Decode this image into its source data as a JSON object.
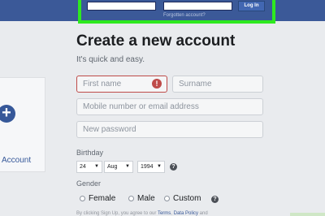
{
  "header": {
    "login_label": "Log In",
    "forgotten_label": "Forgotten account?"
  },
  "left_card": {
    "plus_symbol": "+",
    "account_label": "Account"
  },
  "form": {
    "title": "Create a new account",
    "subtitle": "It's quick and easy.",
    "first_name_placeholder": "First name",
    "surname_placeholder": "Surname",
    "mobile_placeholder": "Mobile number or email address",
    "password_placeholder": "New password",
    "error_symbol": "!",
    "birthday_label": "Birthday",
    "birthday_day": "24",
    "birthday_month": "Aug",
    "birthday_year": "1994",
    "help_symbol": "?",
    "gender_label": "Gender",
    "gender_female": "Female",
    "gender_male": "Male",
    "gender_custom": "Custom",
    "fine_print_prefix": "By clicking Sign Up, you agree to our",
    "fine_terms": "Terms",
    "fine_data_policy": "Data Policy",
    "fine_and": "and"
  },
  "colors": {
    "brand": "#3b5998",
    "highlight": "#2ee91f",
    "error": "#be4b49"
  },
  "icons": {
    "add": "plus-icon",
    "error": "error-icon",
    "help": "help-icon"
  }
}
